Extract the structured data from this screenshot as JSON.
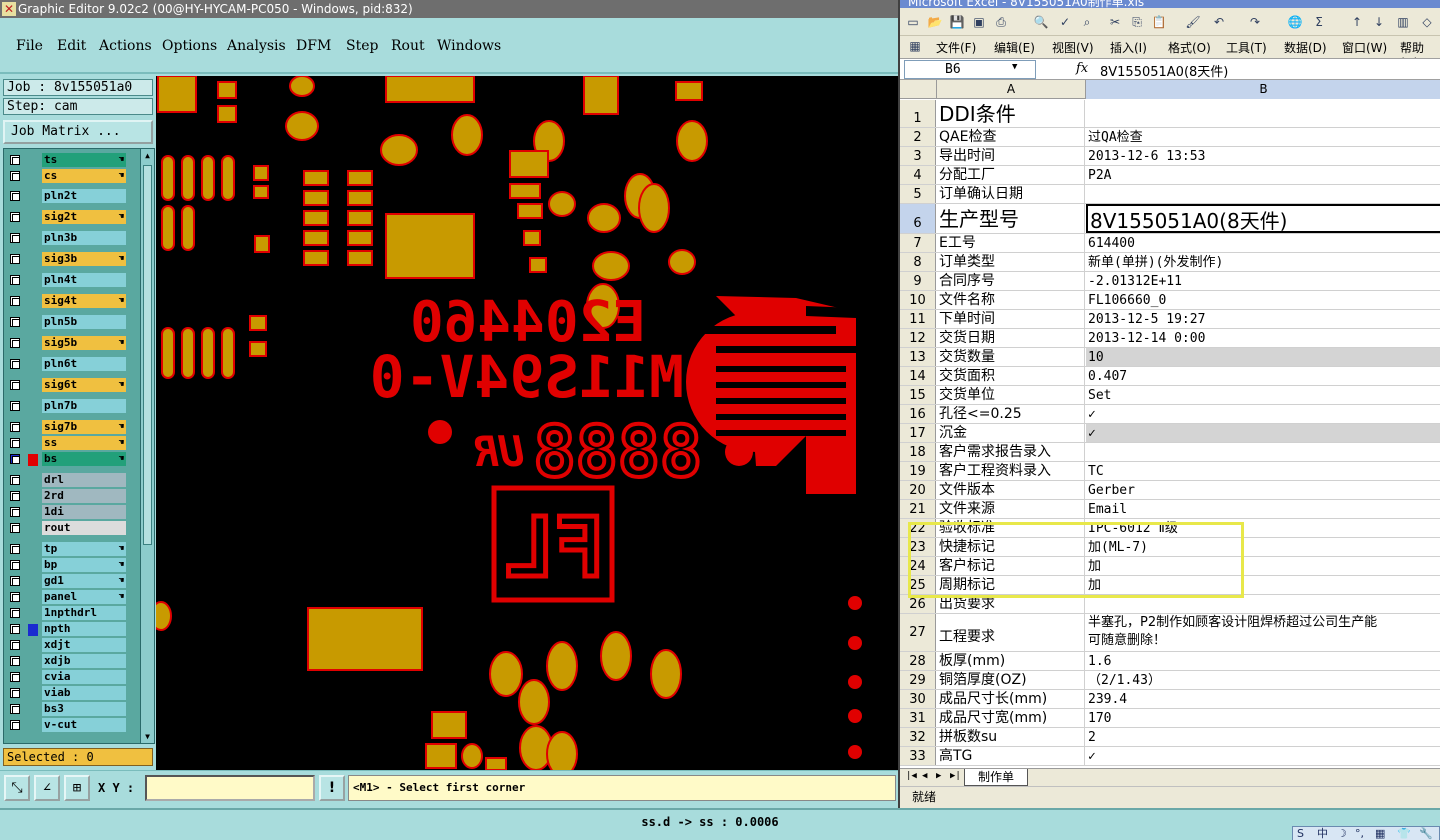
{
  "graphic_editor": {
    "title": "Graphic Editor 9.02c2 (00@HY-HYCAM-PC050 - Windows, pid:832)",
    "menus": [
      "File",
      "Edit",
      "Actions",
      "Options",
      "Analysis",
      "DFM",
      "Step",
      "Rout",
      "Windows"
    ],
    "job_label": "Job : 8v155051a0",
    "step_label": "Step: cam",
    "job_matrix_button": "Job Matrix ...",
    "layers": [
      {
        "name": "ts",
        "color": "#22a07a",
        "hand": true
      },
      {
        "name": "cs",
        "color": "#f0c040",
        "hand": true
      },
      {
        "name": "pln2t",
        "color": "#86d0d8",
        "hand": false
      },
      {
        "name": "sig2t",
        "color": "#f0c040",
        "hand": true
      },
      {
        "name": "pln3b",
        "color": "#86d0d8",
        "hand": false
      },
      {
        "name": "sig3b",
        "color": "#f0c040",
        "hand": true
      },
      {
        "name": "pln4t",
        "color": "#86d0d8",
        "hand": false
      },
      {
        "name": "sig4t",
        "color": "#f0c040",
        "hand": true
      },
      {
        "name": "pln5b",
        "color": "#86d0d8",
        "hand": false
      },
      {
        "name": "sig5b",
        "color": "#f0c040",
        "hand": true
      },
      {
        "name": "pln6t",
        "color": "#86d0d8",
        "hand": false
      },
      {
        "name": "sig6t",
        "color": "#f0c040",
        "hand": true
      },
      {
        "name": "pln7b",
        "color": "#86d0d8",
        "hand": false
      },
      {
        "name": "sig7b",
        "color": "#f0c040",
        "hand": true
      },
      {
        "name": "ss",
        "color": "#f0c040",
        "hand": true
      },
      {
        "name": "bs",
        "color": "#22a07a",
        "hand": true,
        "active": true
      },
      {
        "name": "drl",
        "color": "#a0b8c0",
        "hand": false
      },
      {
        "name": "2rd",
        "color": "#a0b8c0",
        "hand": false
      },
      {
        "name": "1di",
        "color": "#a0b8c0",
        "hand": false
      },
      {
        "name": "rout",
        "color": "#dcdcdc",
        "hand": false
      },
      {
        "name": "tp",
        "color": "#86d0d8",
        "hand": true
      },
      {
        "name": "bp",
        "color": "#86d0d8",
        "hand": true
      },
      {
        "name": "gd1",
        "color": "#86d0d8",
        "hand": true
      },
      {
        "name": "panel",
        "color": "#86d0d8",
        "hand": true
      },
      {
        "name": "1npthdrl",
        "color": "#86d0d8",
        "hand": false
      },
      {
        "name": "npth",
        "color": "#86d0d8",
        "hand": false,
        "marker": "#1a2ad0"
      },
      {
        "name": "xdjt",
        "color": "#86d0d8",
        "hand": false
      },
      {
        "name": "xdjb",
        "color": "#86d0d8",
        "hand": false
      },
      {
        "name": "cvia",
        "color": "#86d0d8",
        "hand": false
      },
      {
        "name": "viab",
        "color": "#86d0d8",
        "hand": false
      },
      {
        "name": "bs3",
        "color": "#86d0d8",
        "hand": false
      },
      {
        "name": "v-cut",
        "color": "#86d0d8",
        "hand": false
      }
    ],
    "selected_label": "Selected : 0",
    "xy_label": "X Y :",
    "xy_value": "",
    "prompt": "<M1> - Select first corner",
    "canvas_text": {
      "part_number": "E204460",
      "ul_code": "M11S94V-0",
      "digits": "8888",
      "ul_mark": "UR",
      "small_mark": "FL"
    },
    "colors": {
      "copper": "#c89a00",
      "outline": "#e00000",
      "silk": "#e00000",
      "bg": "#000000"
    }
  },
  "excel": {
    "title": "Microsoft Excel - 8V155051A0制作单.xls",
    "menus": [
      "文件(F)",
      "编辑(E)",
      "视图(V)",
      "插入(I)",
      "格式(O)",
      "工具(T)",
      "数据(D)",
      "窗口(W)",
      "帮助(H)"
    ],
    "name_box": "B6",
    "fx": "fx",
    "formula": "8V155051A0(8天件)",
    "columns": [
      "A",
      "B"
    ],
    "rows": [
      {
        "n": "1",
        "a": "DDI条件",
        "b": "",
        "big": true
      },
      {
        "n": "2",
        "a": "QAE检查",
        "b": "过QA检查"
      },
      {
        "n": "3",
        "a": "导出时间",
        "b": "2013-12-6 13:53"
      },
      {
        "n": "4",
        "a": "分配工厂",
        "b": "P2A"
      },
      {
        "n": "5",
        "a": "订单确认日期",
        "b": ""
      },
      {
        "n": "6",
        "a": "生产型号",
        "b": "8V155051A0(8天件)",
        "big": true
      },
      {
        "n": "7",
        "a": "E工号",
        "b": "614400"
      },
      {
        "n": "8",
        "a": "订单类型",
        "b": "新单(单拼)(外发制作)"
      },
      {
        "n": "9",
        "a": "合同序号",
        "b": "-2.01312E+11"
      },
      {
        "n": "10",
        "a": "文件名称",
        "b": "FL106660_0"
      },
      {
        "n": "11",
        "a": "下单时间",
        "b": "2013-12-5 19:27"
      },
      {
        "n": "12",
        "a": "交货日期",
        "b": "2013-12-14 0:00"
      },
      {
        "n": "13",
        "a": "交货数量",
        "b": "10",
        "gray": true
      },
      {
        "n": "14",
        "a": "交货面积",
        "b": "0.407"
      },
      {
        "n": "15",
        "a": "交货单位",
        "b": "Set"
      },
      {
        "n": "16",
        "a": "孔径<=0.25",
        "b": "✓"
      },
      {
        "n": "17",
        "a": "沉金",
        "b": "✓",
        "gray": true
      },
      {
        "n": "18",
        "a": "客户需求报告录入",
        "b": ""
      },
      {
        "n": "19",
        "a": "客户工程资料录入",
        "b": "TC"
      },
      {
        "n": "20",
        "a": "文件版本",
        "b": "Gerber"
      },
      {
        "n": "21",
        "a": "文件来源",
        "b": "Email"
      },
      {
        "n": "22",
        "a": "验收标准",
        "b": "IPC-6012 Ⅱ级"
      },
      {
        "n": "23",
        "a": "快捷标记",
        "b": "加(ML-7)"
      },
      {
        "n": "24",
        "a": "客户标记",
        "b": "加"
      },
      {
        "n": "25",
        "a": "周期标记",
        "b": "加"
      },
      {
        "n": "26",
        "a": "出货要求",
        "b": ""
      },
      {
        "n": "27",
        "a": "工程要求",
        "b": "半塞孔，P2制作如顾客设计阻焊桥超过公司生产能",
        "b2": "可随意删除！",
        "tall": true
      },
      {
        "n": "28",
        "a": "板厚(mm)",
        "b": "1.6"
      },
      {
        "n": "29",
        "a": "铜箔厚度(OZ)",
        "b": "（2/1.43）"
      },
      {
        "n": "30",
        "a": "成品尺寸长(mm)",
        "b": "239.4"
      },
      {
        "n": "31",
        "a": "成品尺寸宽(mm)",
        "b": "170"
      },
      {
        "n": "32",
        "a": "拼板数su",
        "b": "2"
      },
      {
        "n": "33",
        "a": "高TG",
        "b": "✓"
      }
    ],
    "sheet_tab": "制作单",
    "status": "就绪"
  },
  "bottom": {
    "status_message": "ss.d -> ss : 0.0006",
    "ime": [
      "S",
      "中",
      "☽",
      "°,",
      "▦",
      "👕",
      "🔧"
    ]
  }
}
